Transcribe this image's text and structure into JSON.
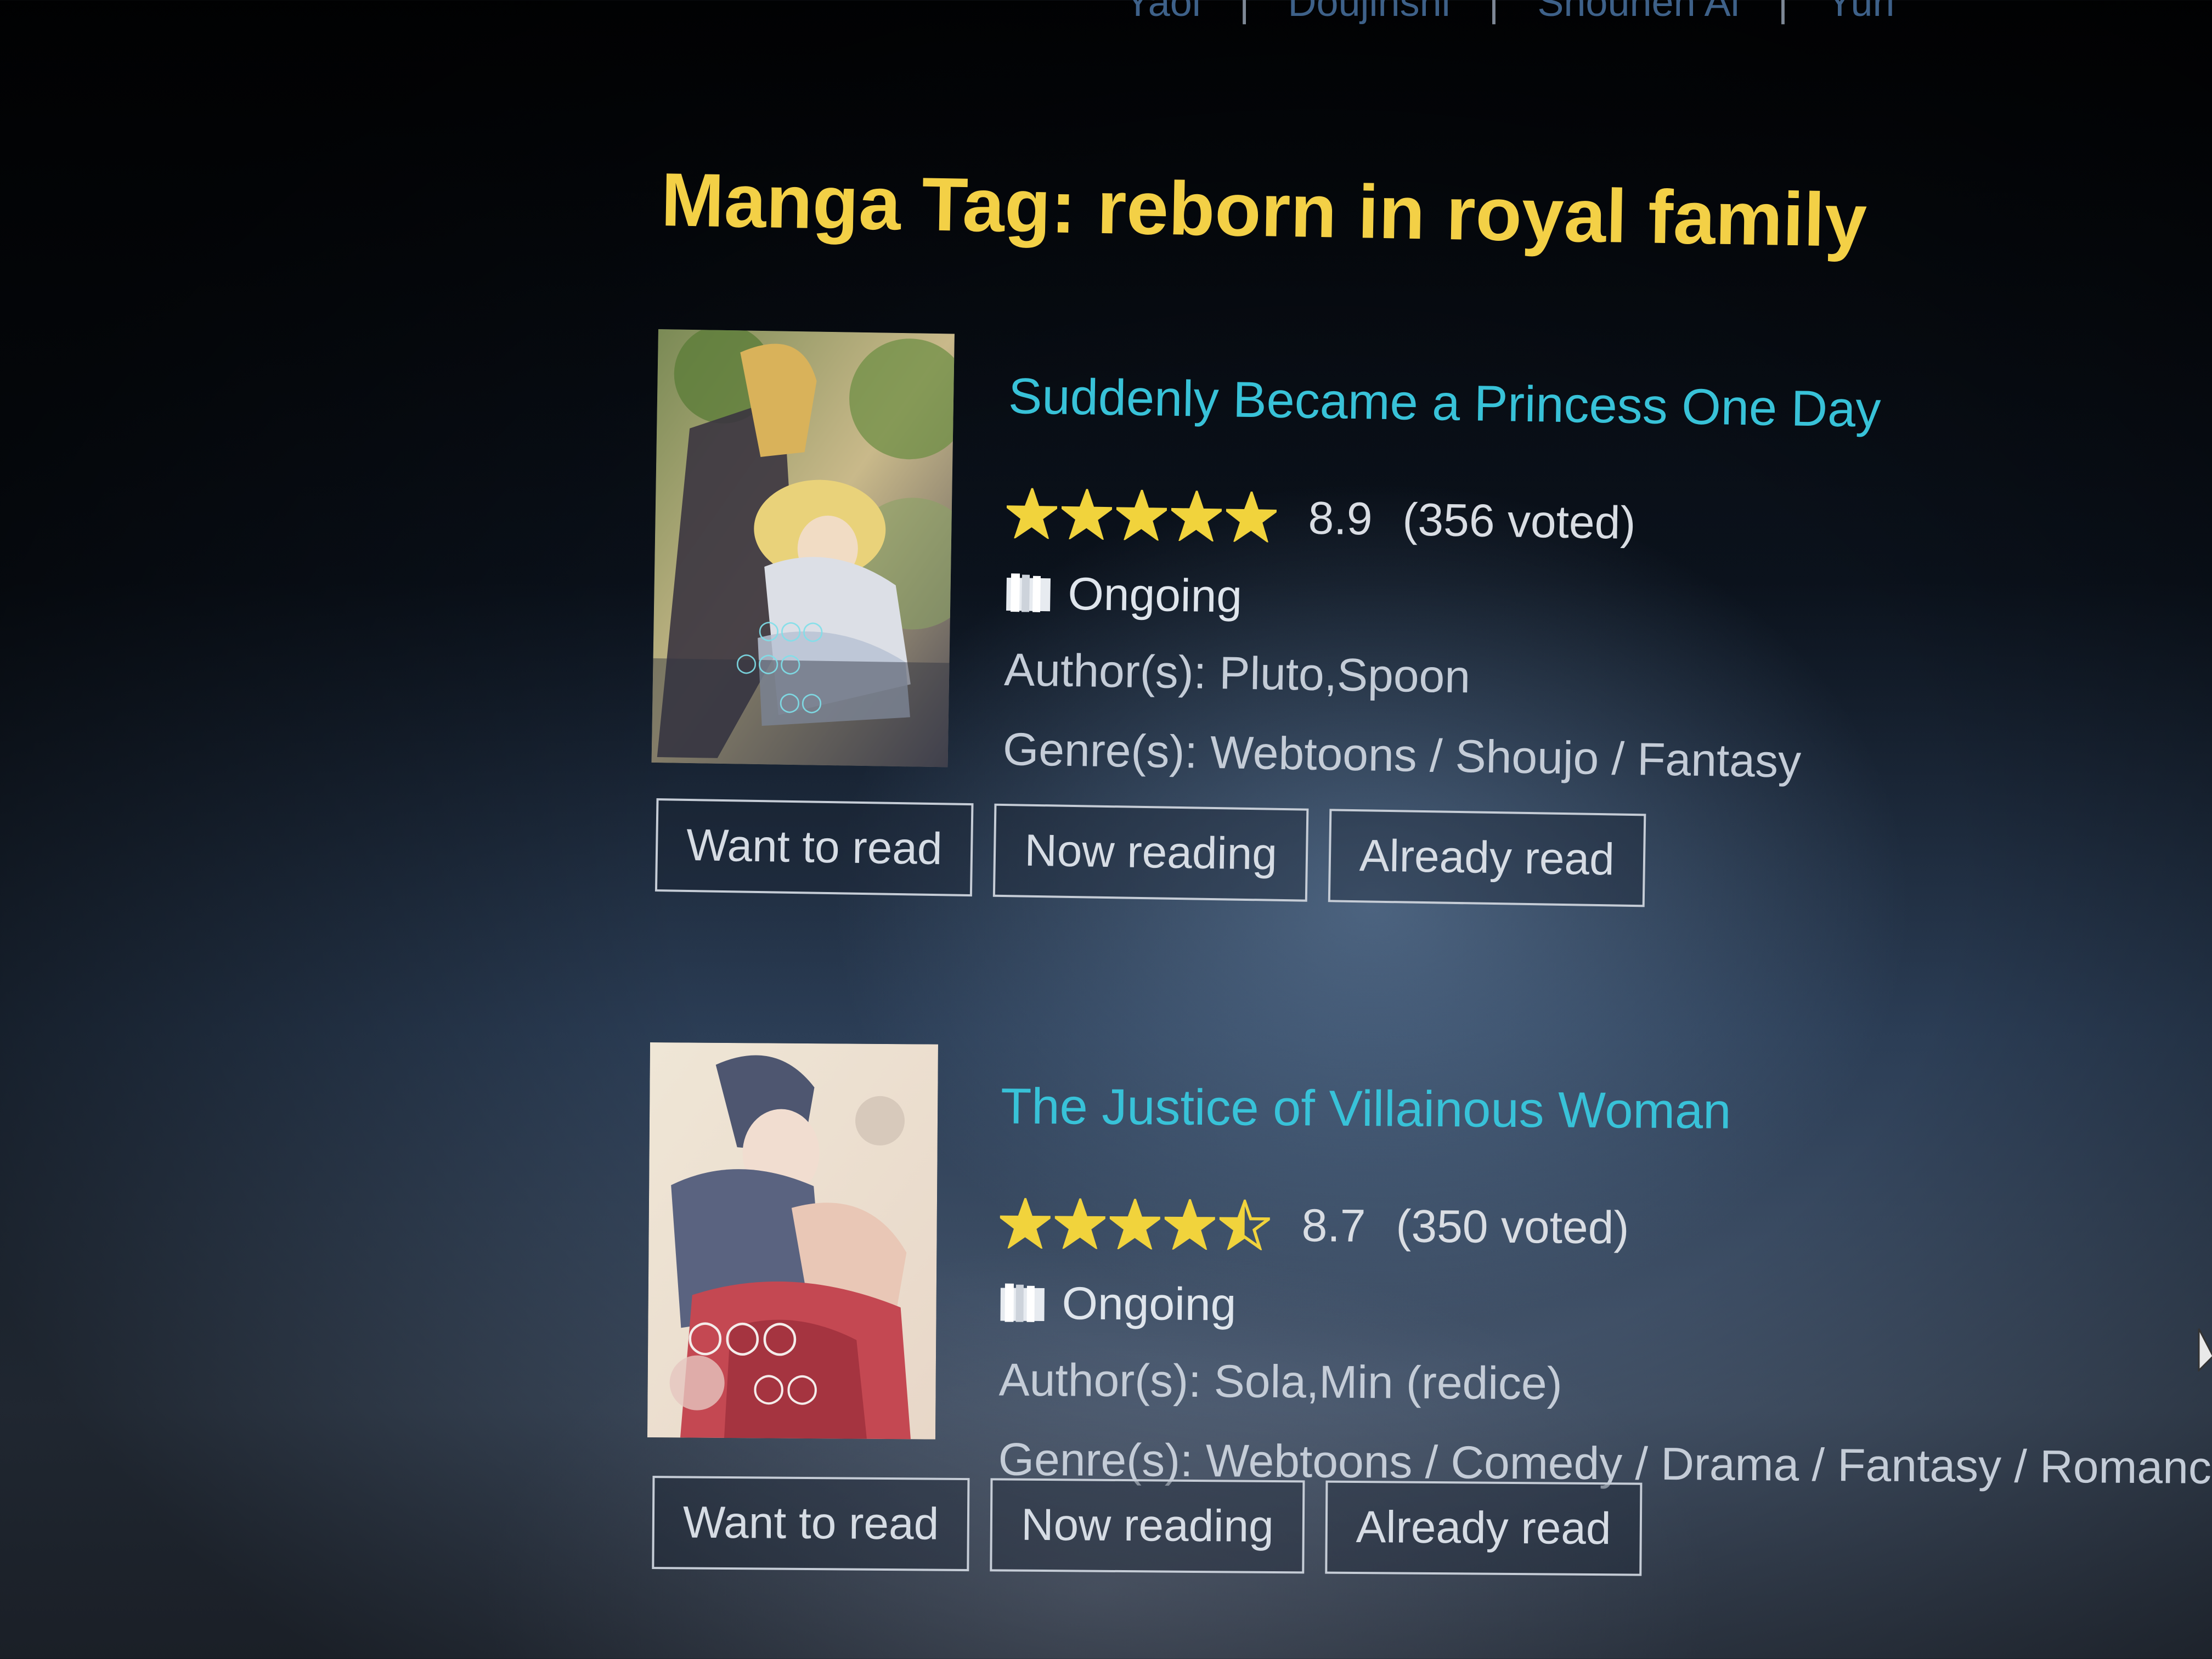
{
  "nav": {
    "items": [
      "Yaoi",
      "Doujinshi",
      "Shounen Ai",
      "Yuri"
    ]
  },
  "page_title": "Manga Tag: reborn in royal family",
  "colors": {
    "title": "#f3d046",
    "link": "#38c2d8",
    "star": "#f1d33c"
  },
  "manga": [
    {
      "title": "Suddenly Became a Princess One Day",
      "rating": "8.9",
      "stars": 5,
      "votes": "(356 voted)",
      "status_icon": "book-icon",
      "status": "Ongoing",
      "authors": "Author(s): Pluto,Spoon",
      "genres": "Genre(s): Webtoons / Shoujo / Fantasy",
      "buttons": {
        "want": "Want to read",
        "now": "Now reading",
        "already": "Already read"
      }
    },
    {
      "title": "The Justice of Villainous Woman",
      "rating": "8.7",
      "stars": 4.5,
      "votes": "(350 voted)",
      "status_icon": "book-icon",
      "status": "Ongoing",
      "authors": "Author(s): Sola,Min (redice)",
      "genres": "Genre(s): Webtoons / Comedy / Drama / Fantasy / Romance",
      "buttons": {
        "want": "Want to read",
        "now": "Now reading",
        "already": "Already read"
      }
    }
  ]
}
